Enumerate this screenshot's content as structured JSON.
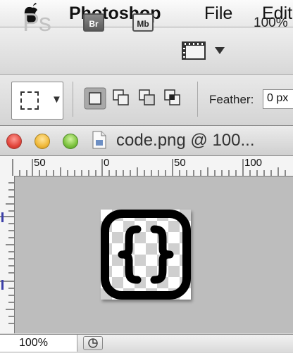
{
  "menubar": {
    "apple_icon": "apple-icon",
    "app_name": "Photoshop",
    "items": [
      {
        "label": "File"
      },
      {
        "label": "Edit"
      }
    ]
  },
  "appbar": {
    "logo_text": "Ps",
    "bridge_label": "Br",
    "minibridge_label": "Mb",
    "view_extras_icon": "film-frame-icon",
    "zoom": "100%"
  },
  "options": {
    "tool_icon": "rectangular-marquee-icon",
    "selection_modes": [
      "new-selection",
      "add-to-selection",
      "subtract-from-selection",
      "intersect-selection"
    ],
    "feather_label": "Feather:",
    "feather_value": "0 px"
  },
  "document": {
    "title": "code.png @ 100..."
  },
  "rulers": {
    "top_labels": [
      "50",
      "0",
      "50",
      "100"
    ]
  },
  "canvas": {
    "image_icon": "curly-braces-icon"
  },
  "status": {
    "zoom": "100%"
  }
}
